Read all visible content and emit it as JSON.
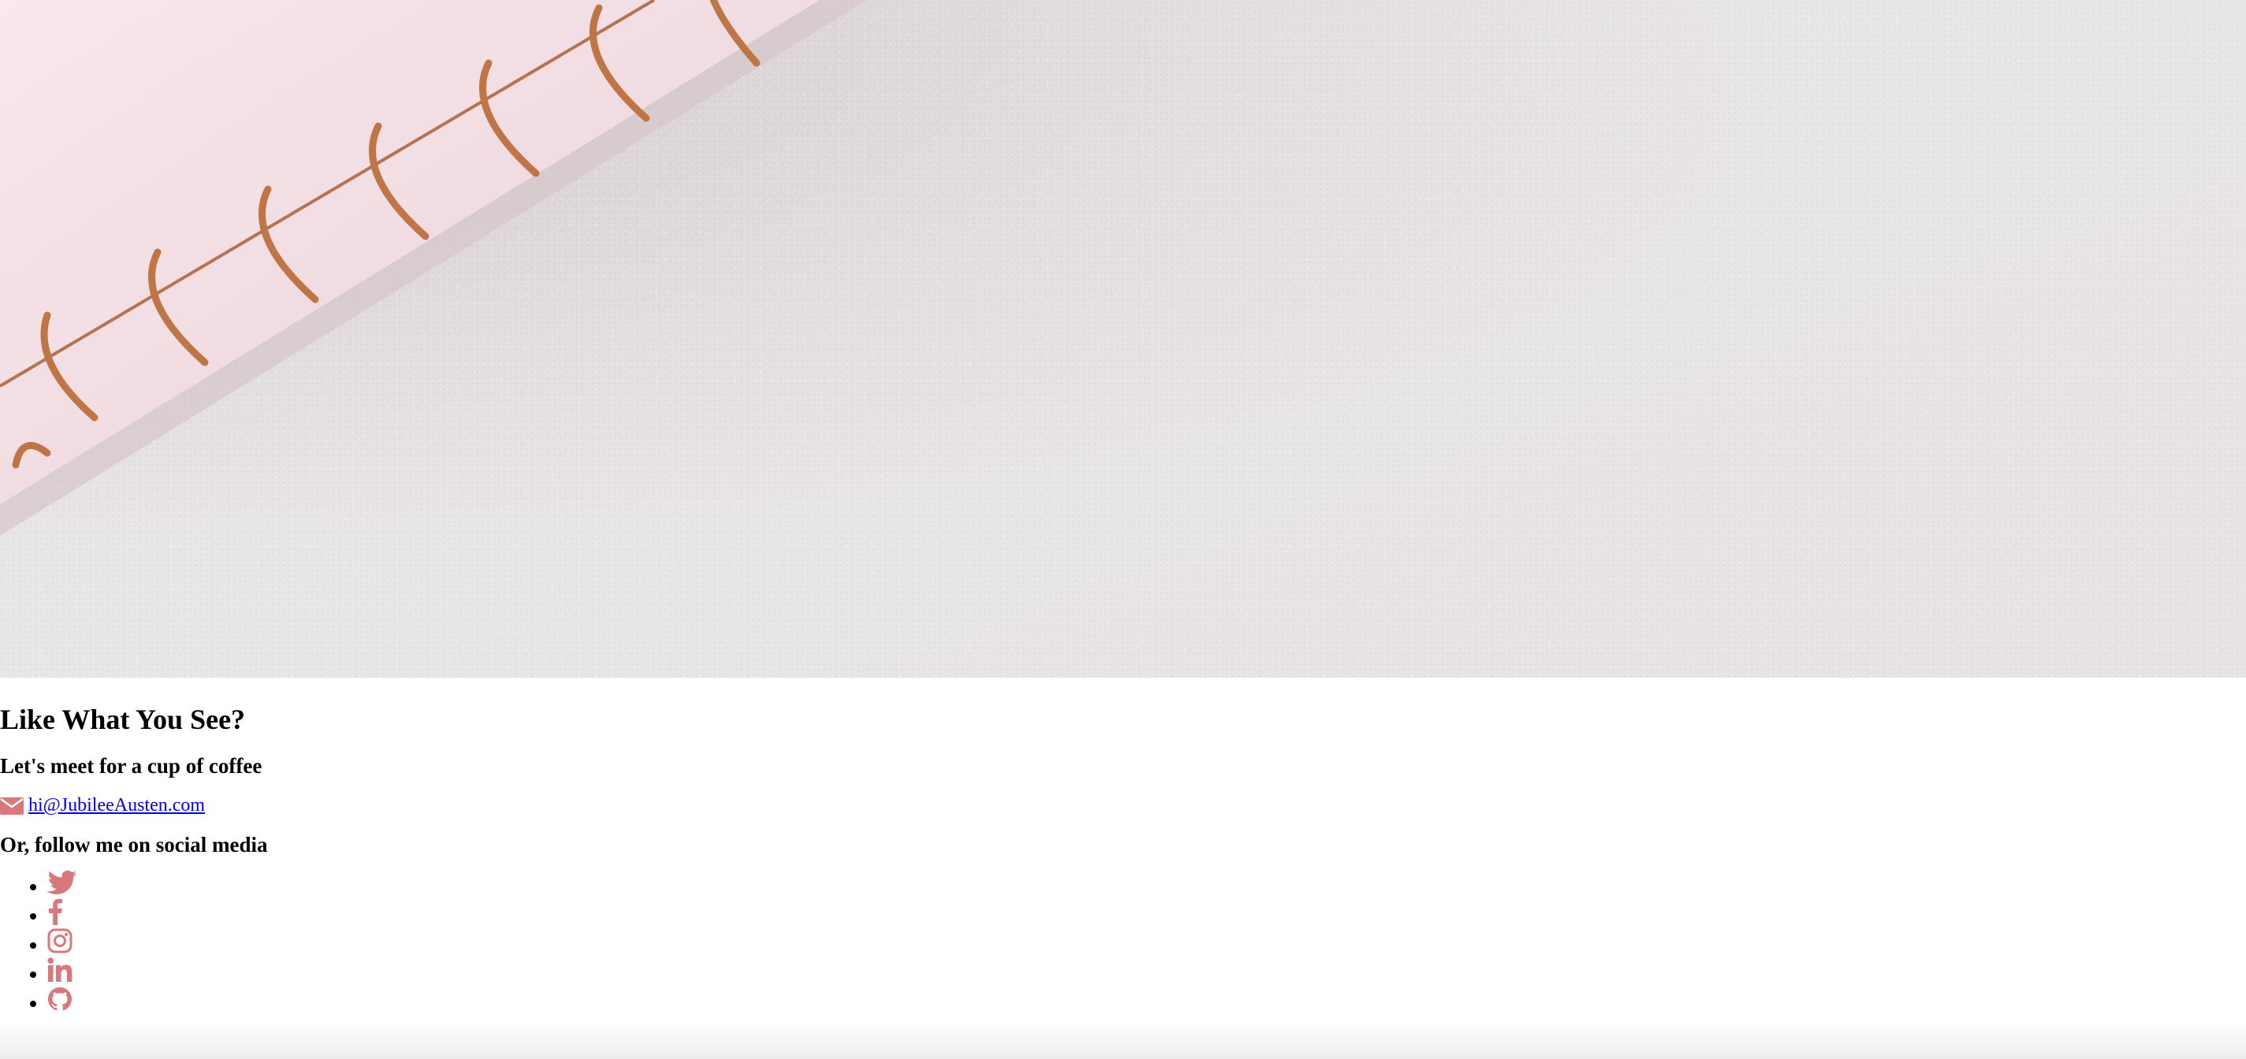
{
  "hero": {
    "image": "notebook-spiral-photo"
  },
  "contact": {
    "heading": "Like What You See?",
    "subheading": "Let's meet for a cup of coffee",
    "email": {
      "icon": "envelope-icon",
      "label": "hi@JubileeAusten.com"
    },
    "social_heading": "Or, follow me on social media",
    "social_links": [
      {
        "icon": "twitter-icon"
      },
      {
        "icon": "facebook-icon"
      },
      {
        "icon": "instagram-icon"
      },
      {
        "icon": "linkedin-icon"
      },
      {
        "icon": "github-icon"
      }
    ]
  },
  "colors": {
    "accent": "#d9787a",
    "link": "#0000ee"
  }
}
